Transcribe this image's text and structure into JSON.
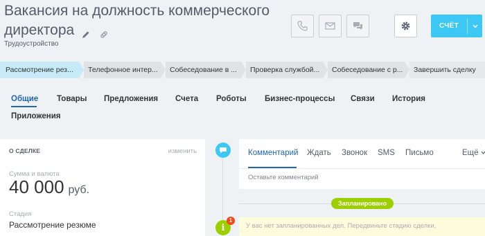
{
  "header": {
    "title": "Вакансия на должность коммерческого директора",
    "subtitle": "Трудоустройство",
    "invoice_label": "СЧЁТ"
  },
  "stages": [
    "Рассмотрение рез...",
    "Телефонное интер...",
    "Собеседование в ...",
    "Проверка службой...",
    "Собеседование с р...",
    "Завершить сделку"
  ],
  "tabs": [
    "Общие",
    "Товары",
    "Предложения",
    "Счета",
    "Роботы",
    "Бизнес-процессы",
    "Связи",
    "История",
    "Приложения"
  ],
  "deal_panel": {
    "heading": "О СДЕЛКЕ",
    "edit_label": "изменить",
    "amount_label": "Сумма и валюта",
    "amount": "40 000",
    "currency": "руб.",
    "stage_label": "Стадия",
    "stage_value": "Рассмотрение резюме"
  },
  "editor": {
    "tabs": [
      "Комментарий",
      "Ждать",
      "Звонок",
      "SMS",
      "Письмо",
      "Ещё"
    ],
    "placeholder": "Оставьте комментарий"
  },
  "timeline": {
    "planned_label": "Запланировано",
    "badge_count": "1",
    "info_glyph": "i",
    "empty_text": "У вас нет запланированных дел. Передвиньте стадию сделки,"
  },
  "colors": {
    "accent": "#3bc8f5",
    "link": "#2067b0",
    "green": "#9dcf00",
    "current_stage": "#c7eaf9"
  }
}
